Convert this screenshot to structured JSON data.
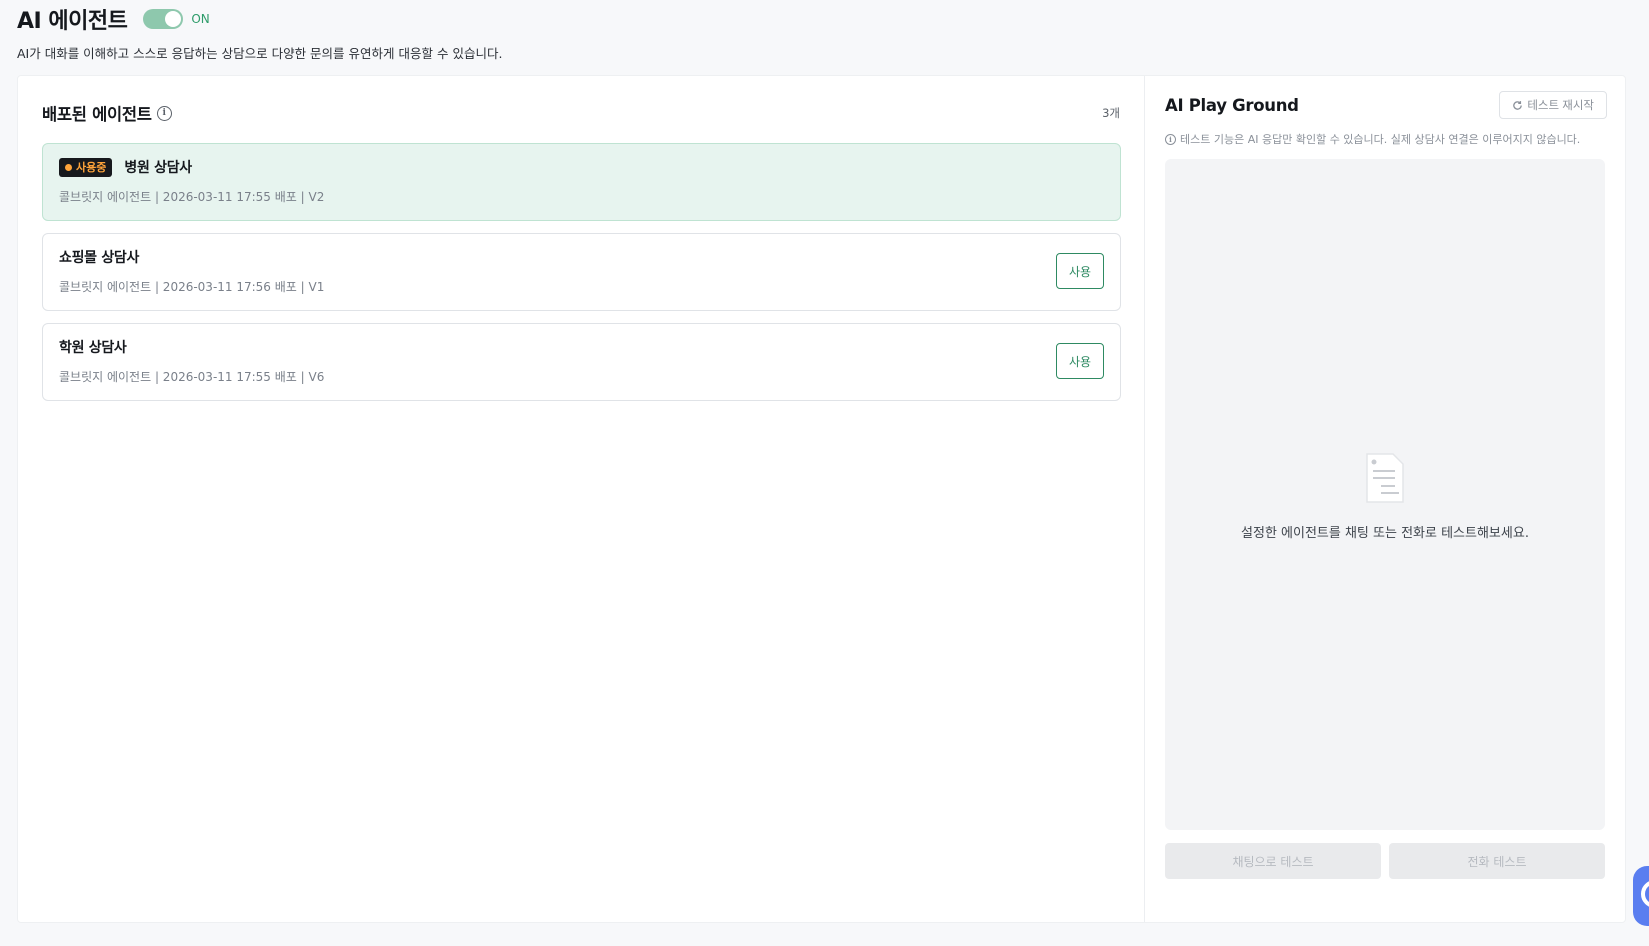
{
  "header": {
    "title": "AI 에이전트",
    "toggle_label": "ON",
    "description": "AI가 대화를 이해하고 스스로 응답하는 상담으로 다양한 문의를 유연하게 대응할 수 있습니다."
  },
  "deployed": {
    "title": "배포된 에이전트",
    "count": "3개",
    "active_badge": "사용중",
    "agents": [
      {
        "name": "병원 상담사",
        "meta": "콜브릿지 에이전트 | 2026-03-11 17:55 배포 | V2",
        "active": true
      },
      {
        "name": "쇼핑몰 상담사",
        "meta": "콜브릿지 에이전트 | 2026-03-11 17:56 배포 | V1",
        "button": "사용"
      },
      {
        "name": "학원 상담사",
        "meta": "콜브릿지 에이전트 | 2026-03-11 17:55 배포 | V6",
        "button": "사용"
      }
    ]
  },
  "playground": {
    "title": "AI Play Ground",
    "restart_label": "테스트 재시작",
    "notice": "테스트 기능은 AI 응답만 확인할 수 있습니다. 실제 상담사 연결은 이루어지지 않습니다.",
    "empty_text": "설정한 에이전트를 채팅 또는 전화로 테스트해보세요.",
    "chat_test_label": "채팅으로 테스트",
    "call_test_label": "전화 테스트"
  },
  "colors": {
    "accent_green": "#2e8a62",
    "toggle_on": "#8ec8ad",
    "active_card_bg": "#e7f4ef",
    "badge_bg": "#17191d",
    "badge_text": "#ffa43a",
    "widget_blue": "#5a7ef0"
  },
  "icons": {
    "info": "info-circle-icon",
    "restart": "refresh-icon",
    "empty_state": "document-icon"
  }
}
